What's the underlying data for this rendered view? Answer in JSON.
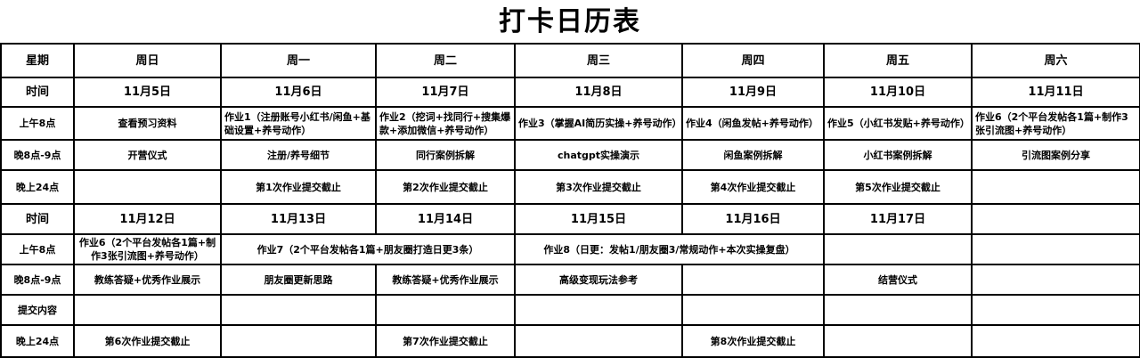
{
  "title": "打卡日历表",
  "header": {
    "label": "星期",
    "days": [
      "周日",
      "周一",
      "周二",
      "周三",
      "周四",
      "周五",
      "周六"
    ]
  },
  "week1": {
    "date_label": "时间",
    "dates": [
      "11月5日",
      "11月6日",
      "11月7日",
      "11月8日",
      "11月9日",
      "11月10日",
      "11月11日"
    ],
    "morning_label": "上午8点",
    "morning": [
      "查看预习资料",
      "作业1（注册账号小红书/闲鱼+基础设置+养号动作）",
      "作业2（挖词+找同行+搜集爆款+添加微信+养号动作）",
      "作业3（掌握AI简历实操+养号动作）",
      "作业4（闲鱼发帖+养号动作）",
      "作业5（小红书发贴+养号动作）",
      "作业6（2个平台发帖各1篇+制作3张引流图+养号动作）"
    ],
    "evening_label": "晚8点-9点",
    "evening": [
      "开营仪式",
      "注册/养号细节",
      "同行案例拆解",
      "chatgpt实操演示",
      "闲鱼案例拆解",
      "小红书案例拆解",
      "引流图案例分享"
    ],
    "deadline_label": "晚上24点",
    "deadline": [
      "",
      "第1次作业提交截止",
      "第2次作业提交截止",
      "第3次作业提交截止",
      "第4次作业提交截止",
      "第5次作业提交截止",
      ""
    ]
  },
  "week2": {
    "date_label": "时间",
    "dates": [
      "11月12日",
      "11月13日",
      "11月14日",
      "11月15日",
      "11月16日",
      "11月17日",
      ""
    ],
    "morning_label": "上午8点",
    "morning": [
      {
        "text": "作业6（2个平台发帖各1篇+制作3张引流图+养号动作）",
        "span": 1
      },
      {
        "text": "作业7（2个平台发帖各1篇+朋友圈打造日更3条）",
        "span": 2
      },
      {
        "text": "作业8（日更：发帖1/朋友圈3/常规动作+本次实操复盘）",
        "span": 2
      },
      {
        "text": "",
        "span": 1
      },
      {
        "text": "",
        "span": 1
      }
    ],
    "evening_label": "晚8点-9点",
    "evening": [
      "教练答疑+优秀作业展示",
      "朋友圈更新思路",
      "教练答疑+优秀作业展示",
      "高级变现玩法参考",
      "",
      "结营仪式",
      ""
    ],
    "submit_label": "提交内容",
    "submit": [
      "",
      "",
      "",
      "",
      "",
      "",
      ""
    ],
    "deadline_label": "晚上24点",
    "deadline": [
      "第6次作业提交截止",
      "",
      "第7次作业提交截止",
      "",
      "第8次作业提交截止",
      "",
      ""
    ]
  }
}
